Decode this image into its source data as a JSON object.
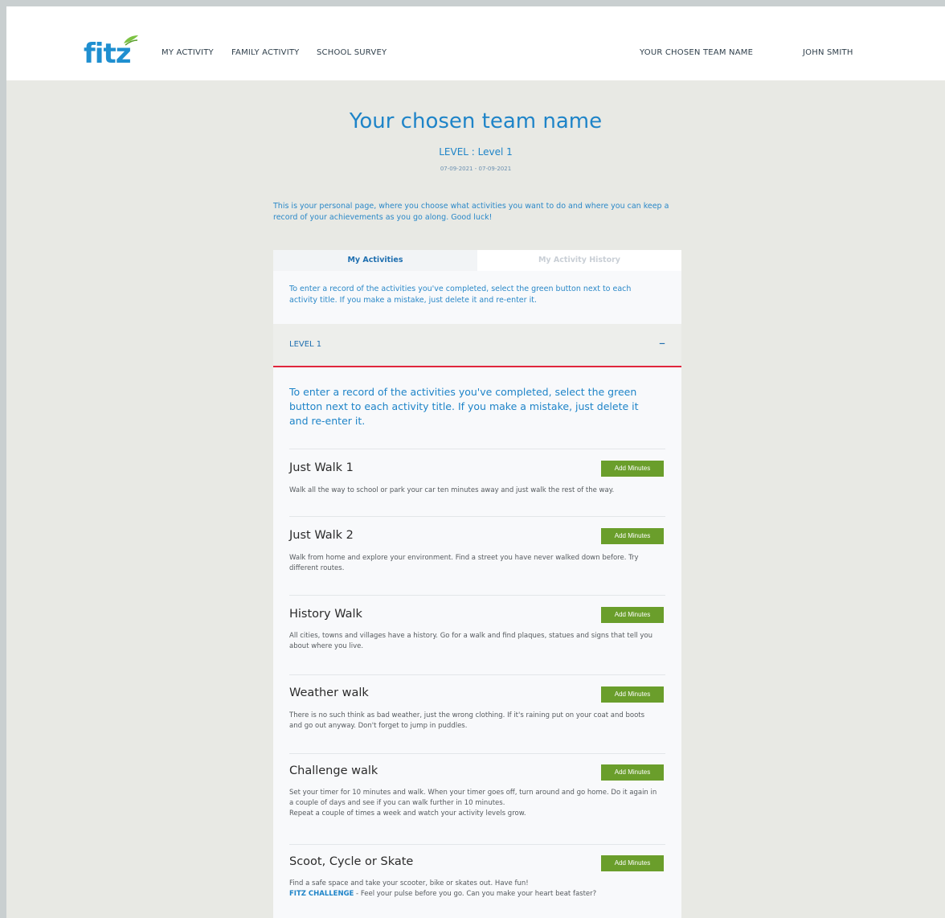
{
  "brand": {
    "logo_text": "fitz"
  },
  "nav": {
    "my_activity": "MY ACTIVITY",
    "family_activity": "FAMILY ACTIVITY",
    "school_survey": "SCHOOL SURVEY",
    "team_name": "YOUR CHOSEN TEAM NAME",
    "user_name": "JOHN SMITH"
  },
  "hero": {
    "title": "Your chosen team name",
    "level": "LEVEL : Level 1",
    "dates": "07-09-2021 - 07-09-2021"
  },
  "intro": "This is your personal page, where you choose what activities you want to do and where you can keep a record of your achievements as you go along. Good luck!",
  "tabs": [
    {
      "label": "My Activities"
    },
    {
      "label": "My Activity History"
    }
  ],
  "panel_intro": "To enter a record of the activities you've completed, select the green button next to each activity title. If you make a mistake, just delete it and re-enter it.",
  "accordion": {
    "label": "LEVEL 1",
    "toggle": "–"
  },
  "section_lead": "To enter a record of the activities you've completed, select the green button next to each activity title. If you make a mistake, just delete it and re-enter it.",
  "button_label": "Add Minutes",
  "activities": [
    {
      "title": "Just Walk 1",
      "desc": "Walk all the way to school or park your car ten minutes away and just walk the rest of the way."
    },
    {
      "title": "Just Walk 2",
      "desc": "Walk from home and explore your environment. Find a street you have never walked down before. Try different routes."
    },
    {
      "title": "History Walk",
      "desc": "All cities, towns and villages have a history. Go for a walk and find plaques, statues and signs that tell you about where you live."
    },
    {
      "title": "Weather walk",
      "desc": "There is no such think as bad weather, just the wrong clothing. If it's raining put on your coat and boots and go out anyway. Don't forget to jump in puddles."
    },
    {
      "title": "Challenge walk",
      "desc": "Set your timer for 10 minutes and walk. When your timer goes off, turn around and go home. Do it again in a couple of days and see if you can walk further in 10 minutes.",
      "desc2": "Repeat a couple of times a week and watch your activity levels grow."
    },
    {
      "title": "Scoot, Cycle or Skate",
      "desc": "Find a safe space and take your scooter, bike or skates out. Have fun!",
      "challenge_label": "FITZ CHALLENGE",
      "challenge_text": " - Feel your pulse before you go. Can you make your heart beat faster?"
    }
  ],
  "colors": {
    "brand_blue": "#1e84c8",
    "button_green": "#6a9e2b",
    "accent_red": "#e0263c",
    "page_bg": "#e8e9e4"
  }
}
